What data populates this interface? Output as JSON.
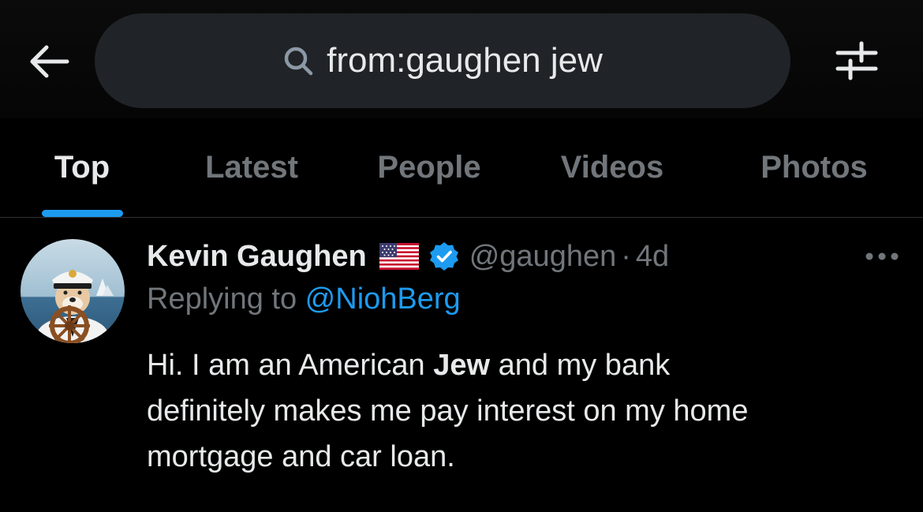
{
  "search": {
    "query": "from:gaughen jew"
  },
  "tabs": [
    {
      "label": "Top",
      "active": true
    },
    {
      "label": "Latest",
      "active": false
    },
    {
      "label": "People",
      "active": false
    },
    {
      "label": "Videos",
      "active": false
    },
    {
      "label": "Photos",
      "active": false
    }
  ],
  "tweet": {
    "author_name": "Kevin Gaughen",
    "handle": "@gaughen",
    "separator": "·",
    "timestamp": "4d",
    "replying_label": "Replying to ",
    "replying_to": "@NiohBerg",
    "body": {
      "line1_a": "Hi. I am an American ",
      "line1_b": "Jew",
      "line1_c": " and my bank",
      "line2": "definitely makes me pay interest on my home",
      "line3": "mortgage and car loan."
    }
  },
  "colors": {
    "accent": "#1d9bf0",
    "text": "#e7e9ea",
    "muted": "#71767b",
    "search_bg": "#202327",
    "background": "#000000"
  },
  "icons": {
    "back": "arrow-left-icon",
    "search": "search-icon",
    "filter": "sliders-icon",
    "flag": "us-flag-icon",
    "verified": "verified-badge-icon",
    "more": "more-horizontal-icon"
  }
}
